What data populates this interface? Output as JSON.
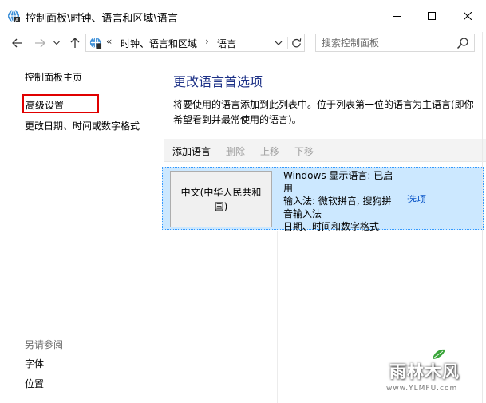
{
  "window": {
    "title": "控制面板\\时钟、语言和区域\\语言",
    "icons": {
      "app": "control-panel-icon",
      "minimize": "minimize-icon",
      "maximize": "maximize-icon",
      "close": "close-icon"
    }
  },
  "address_bar": {
    "overflow": "«",
    "crumbs": [
      "时钟、语言和区域",
      "语言"
    ],
    "separator": "›",
    "search_placeholder": "搜索控制面板"
  },
  "left_nav": {
    "home": "控制面板主页",
    "advanced": "高级设置",
    "date_time": "更改日期、时间或数字格式",
    "see_also": "另请参阅",
    "fonts": "字体",
    "location": "位置"
  },
  "main": {
    "title": "更改语言首选项",
    "description": "将要使用的语言添加到此列表中。位于列表第一位的语言为主语言(即你希望看到并最常使用的语言)。",
    "toolbar": {
      "add": "添加语言",
      "remove": "删除",
      "move_up": "上移",
      "move_down": "下移"
    },
    "languages": [
      {
        "name": "中文(中华人民共和国)",
        "details": [
          "Windows 显示语言: 已启用",
          "输入法: 微软拼音, 搜狗拼音输入法",
          "日期、时间和数字格式"
        ],
        "options": "选项"
      }
    ]
  },
  "watermark": {
    "text": "雨林木风",
    "url": "www.YLMFU.com"
  },
  "colors": {
    "accent_title": "#1e3287",
    "link": "#0b56c8",
    "selection": "#cce8ff",
    "highlight_box": "#e00000"
  }
}
